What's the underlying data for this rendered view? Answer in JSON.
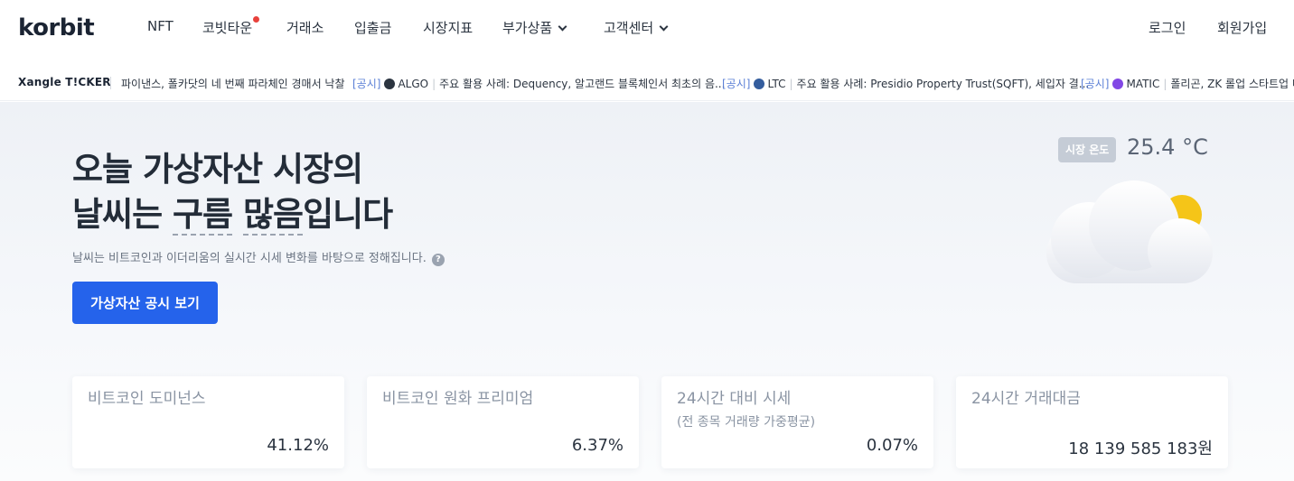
{
  "header": {
    "logo": "korbit",
    "nav": [
      {
        "label": "NFT"
      },
      {
        "label": "코빗타운"
      },
      {
        "label": "거래소"
      },
      {
        "label": "입출금"
      },
      {
        "label": "시장지표"
      },
      {
        "label": "부가상품"
      },
      {
        "label": "고객센터"
      }
    ],
    "login": "로그인",
    "signup": "회원가입"
  },
  "ticker": {
    "brand": "Xangle T!CKER",
    "items": [
      {
        "tag": "",
        "coin": "",
        "text": "파이낸스, 폴카닷의 네 번째 파라체인 경매서 낙찰"
      },
      {
        "tag": "[공시]",
        "coin": "ALGO",
        "text": "주요 활용 사례: Dequency, 알고랜드 블록체인서 최초의 음..."
      },
      {
        "tag": "[공시]",
        "coin": "LTC",
        "text": "주요 활용 사례: Presidio Property Trust(SQFT), 세입자 결..."
      },
      {
        "tag": "[공시]",
        "coin": "MATIC",
        "text": "폴리곤, ZK 롤업 스타트업 미"
      }
    ]
  },
  "hero": {
    "title_line1": "오늘 가상자산 시장의",
    "title_line2_pre": "날씨는 ",
    "title_line2_word1": "구름",
    "title_line2_word2": "많음",
    "title_line2_post": "입니다",
    "subtitle": "날씨는 비트코인과 이더리움의 실시간 시세 변화를 바탕으로 정해집니다.",
    "help": "?",
    "cta": "가상자산 공시 보기",
    "temperature_label": "시장 온도",
    "temperature_value": "25.4 °C"
  },
  "cards": [
    {
      "title": "비트코인 도미넌스",
      "sub": "",
      "value": "41.12%"
    },
    {
      "title": "비트코인 원화 프리미엄",
      "sub": "",
      "value": "6.37%"
    },
    {
      "title": "24시간 대비 시세",
      "sub": "(전 종목 거래량 가중평균)",
      "value": "0.07%"
    },
    {
      "title": "24시간 거래대금",
      "sub": "",
      "value": "18 139 585 183원"
    }
  ],
  "colors": {
    "accent": "#2563eb",
    "notify_dot": "#e8413c",
    "ticker_tag": "#5a7fd6",
    "sun": "#f5c518"
  }
}
